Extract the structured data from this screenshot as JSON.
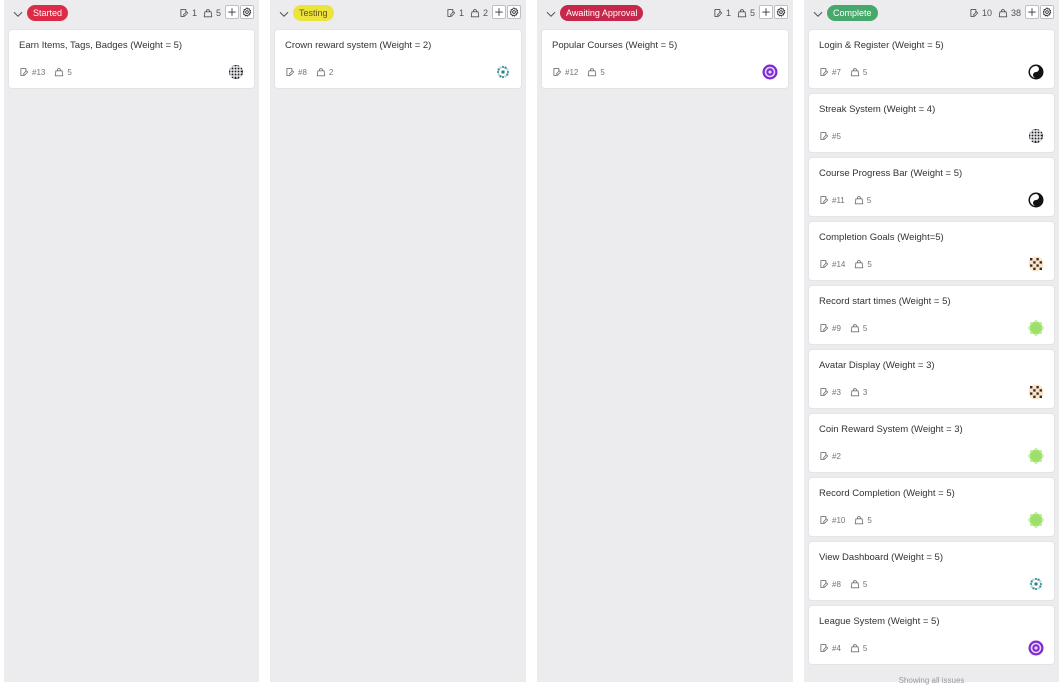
{
  "columns": [
    {
      "label": "Started",
      "label_color": "#dd2b47",
      "label_text_color": "#ffffff",
      "issue_count": "1",
      "weight_total": "5",
      "cards": [
        {
          "title": "Earn Items, Tags, Badges (Weight = 5)",
          "id": "#13",
          "weight": "5",
          "avatar": "grid-dark"
        }
      ]
    },
    {
      "label": "Testing",
      "label_color": "#ede33d",
      "label_text_color": "#5c5414",
      "issue_count": "1",
      "weight_total": "2",
      "cards": [
        {
          "title": "Crown reward system (Weight = 2)",
          "id": "#8",
          "weight": "2",
          "avatar": "teal-sparkle"
        }
      ]
    },
    {
      "label": "Awaiting Approval",
      "label_color": "#c4284a",
      "label_text_color": "#ffffff",
      "issue_count": "1",
      "weight_total": "5",
      "cards": [
        {
          "title": "Popular Courses (Weight = 5)",
          "id": "#12",
          "weight": "5",
          "avatar": "purple-flower"
        }
      ]
    },
    {
      "label": "Complete",
      "label_color": "#46a86a",
      "label_text_color": "#ffffff",
      "issue_count": "10",
      "weight_total": "38",
      "cards": [
        {
          "title": "Login & Register (Weight = 5)",
          "id": "#7",
          "weight": "5",
          "avatar": "black-swirl"
        },
        {
          "title": "Streak System (Weight = 4)",
          "id": "#5",
          "weight": "",
          "avatar": "grid-dark"
        },
        {
          "title": "Course Progress Bar (Weight = 5)",
          "id": "#11",
          "weight": "5",
          "avatar": "black-swirl"
        },
        {
          "title": "Completion Goals (Weight=5)",
          "id": "#14",
          "weight": "5",
          "avatar": "brown-pattern"
        },
        {
          "title": "Record start times (Weight = 5)",
          "id": "#9",
          "weight": "5",
          "avatar": "green-blob"
        },
        {
          "title": "Avatar Display (Weight = 3)",
          "id": "#3",
          "weight": "3",
          "avatar": "brown-pattern"
        },
        {
          "title": "Coin Reward System (Weight = 3)",
          "id": "#2",
          "weight": "",
          "avatar": "green-blob"
        },
        {
          "title": "Record Completion (Weight = 5)",
          "id": "#10",
          "weight": "5",
          "avatar": "green-blob"
        },
        {
          "title": "View Dashboard (Weight = 5)",
          "id": "#8",
          "weight": "5",
          "avatar": "teal-sparkle"
        },
        {
          "title": "League System (Weight = 5)",
          "id": "#4",
          "weight": "5",
          "avatar": "purple-flower"
        }
      ],
      "footer": "Showing all issues"
    }
  ],
  "icons": {
    "collapse": "chevron-down-icon",
    "issues": "issues-icon",
    "weight": "weight-icon",
    "add": "plus-icon",
    "settings": "gear-icon"
  }
}
